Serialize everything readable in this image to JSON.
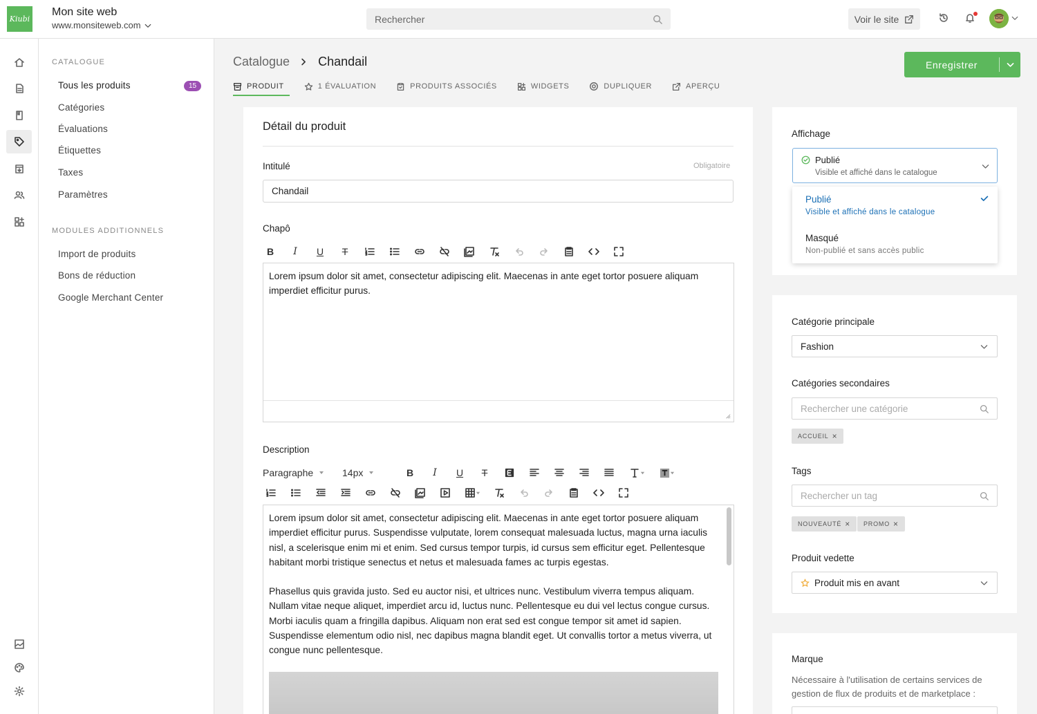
{
  "topbar": {
    "logo_text": "Kiubi",
    "site_name": "Mon site web",
    "site_url": "www.monsiteweb.com",
    "search_placeholder": "Rechercher",
    "view_site_label": "Voir le site"
  },
  "subnav": {
    "section_catalog": "CATALOGUE",
    "items": [
      {
        "label": "Tous les produits",
        "badge": "15"
      },
      {
        "label": "Catégories"
      },
      {
        "label": "Évaluations"
      },
      {
        "label": "Étiquettes"
      },
      {
        "label": "Taxes"
      },
      {
        "label": "Paramètres"
      }
    ],
    "section_modules": "MODULES ADDITIONNELS",
    "module_items": [
      {
        "label": "Import de produits"
      },
      {
        "label": "Bons de réduction"
      },
      {
        "label": "Google Merchant Center"
      }
    ]
  },
  "header": {
    "breadcrumb_root": "Catalogue",
    "breadcrumb_current": "Chandail",
    "save_label": "Enregistrer",
    "tabs": [
      {
        "label": "PRODUIT",
        "icon": "archive-icon"
      },
      {
        "label": "1 ÉVALUATION",
        "icon": "star-icon"
      },
      {
        "label": "PRODUITS ASSOCIÉS",
        "icon": "clipboard-icon"
      },
      {
        "label": "WIDGETS",
        "icon": "widgets-icon"
      },
      {
        "label": "DUPLIQUER",
        "icon": "duplicate-icon"
      },
      {
        "label": "APERÇU",
        "icon": "external-icon"
      }
    ]
  },
  "product": {
    "card_title": "Détail du produit",
    "title_label": "Intitulé",
    "required_label": "Obligatoire",
    "title_value": "Chandail",
    "chapo_label": "Chapô",
    "chapo_text": "Lorem ipsum dolor sit amet, consectetur adipiscing elit. Maecenas in ante eget tortor posuere aliquam imperdiet efficitur purus.",
    "description_label": "Description",
    "paragraph_select": "Paragraphe",
    "font_size_select": "14px",
    "description_p1": "Lorem ipsum dolor sit amet, consectetur adipiscing elit. Maecenas in ante eget tortor posuere aliquam imperdiet efficitur purus. Suspendisse vulputate, lorem consequat malesuada luctus, magna urna iaculis nisl, a scelerisque enim mi et enim. Sed cursus tempor turpis, id cursus sem efficitur eget. Pellentesque habitant morbi tristique senectus et netus et malesuada fames ac turpis egestas.",
    "description_p2": "Phasellus quis gravida justo. Sed eu auctor nisi, et ultrices nunc. Vestibulum viverra tempus aliquam. Nullam vitae neque aliquet, imperdiet arcu id, luctus nunc. Pellentesque eu dui vel lectus congue cursus. Morbi iaculis quam a fringilla dapibus. Aliquam non erat sed est congue tempor sit amet id sapien. Suspendisse elementum odio nisl, nec dapibus magna blandit eget. Ut convallis tortor a metus viverra, ut congue nunc pellentesque."
  },
  "display": {
    "title": "Affichage",
    "selected_label": "Publié",
    "selected_desc": "Visible et affiché dans le catalogue",
    "options": [
      {
        "label": "Publié",
        "desc": "Visible et affiché dans le catalogue",
        "checked": true
      },
      {
        "label": "Masqué",
        "desc": "Non-publié et sans accès public"
      }
    ]
  },
  "categories": {
    "main_title": "Catégorie principale",
    "main_value": "Fashion",
    "secondary_title": "Catégories secondaires",
    "secondary_placeholder": "Rechercher une catégorie",
    "secondary_chips": [
      "ACCUEIL"
    ],
    "tags_title": "Tags",
    "tags_placeholder": "Rechercher un tag",
    "tag_chips": [
      "NOUVEAUTÉ",
      "PROMO"
    ],
    "featured_title": "Produit vedette",
    "featured_value": "Produit mis en avant"
  },
  "brand": {
    "title": "Marque",
    "help": "Nécessaire à l'utilisation de certains services de gestion de flux de produits et de marketplace :"
  },
  "colors": {
    "accent": "#5cb85c",
    "badge": "#9c4fb3",
    "link": "#1a6fb5",
    "star": "#f0a830"
  }
}
